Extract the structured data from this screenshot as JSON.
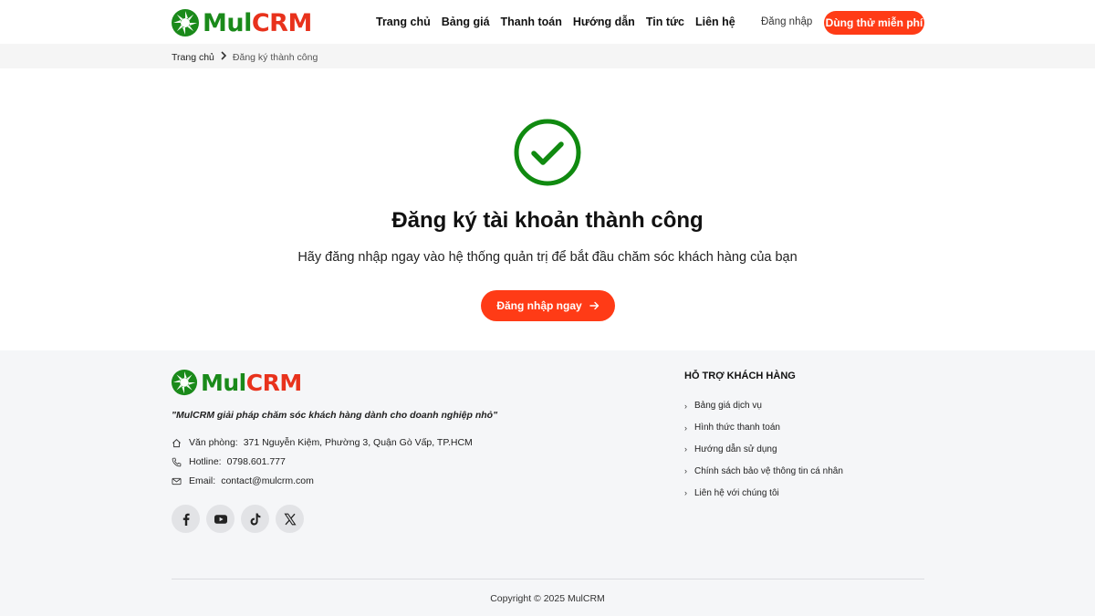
{
  "brand": {
    "name_part1": "Mul",
    "name_part2": "CRM",
    "green": "#1a8a1a",
    "orange": "#e8321c"
  },
  "header": {
    "nav": [
      "Trang chủ",
      "Bảng giá",
      "Thanh toán",
      "Hướng dẫn",
      "Tin tức",
      "Liên hệ"
    ],
    "login_label": "Đăng nhập",
    "trial_label": "Dùng thử miễn phí"
  },
  "breadcrumb": {
    "home": "Trang chủ",
    "current": "Đăng ký thành công"
  },
  "main": {
    "icon": "check-circle-icon",
    "title": "Đăng ký tài khoản thành công",
    "subtitle": "Hãy đăng nhập ngay vào hệ thống quản trị để bắt đầu chăm sóc khách hàng của bạn",
    "cta_label": "Đăng nhập ngay",
    "cta_icon": "arrow-right-icon",
    "accent": "#ff3b16",
    "success": "#108a10"
  },
  "footer": {
    "tagline": "\"MulCRM giải pháp chăm sóc khách hàng dành cho doanh nghiệp nhỏ\"",
    "office_label": "Văn phòng:",
    "office_value": "371 Nguyễn Kiệm, Phường 3, Quận Gò Vấp, TP.HCM",
    "hotline_label": "Hotline:",
    "hotline_value": "0798.601.777",
    "email_label": "Email:",
    "email_value": "contact@mulcrm.com",
    "socials": [
      "facebook-icon",
      "youtube-icon",
      "tiktok-icon",
      "x-icon"
    ],
    "support_title": "HỖ TRỢ KHÁCH HÀNG",
    "support_links": [
      "Bảng giá dịch vụ",
      "Hình thức thanh toán",
      "Hướng dẫn sử dụng",
      "Chính sách bảo vệ thông tin cá nhân",
      "Liên hệ với chúng tôi"
    ],
    "copyright": "Copyright © 2025 MulCRM"
  }
}
